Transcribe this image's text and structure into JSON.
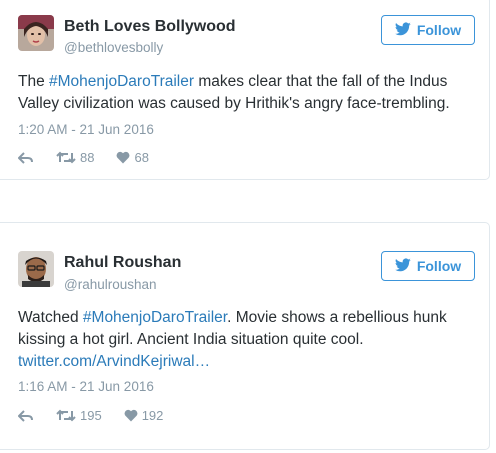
{
  "tweets": [
    {
      "name": "Beth Loves Bollywood",
      "handle": "@bethlovesbolly",
      "follow_label": "Follow",
      "text_parts": [
        "The ",
        "#MohenjoDaroTrailer",
        " makes clear that the fall of the Indus Valley civilization was caused by Hrithik's angry face-trembling."
      ],
      "timestamp": "1:20 AM - 21 Jun 2016",
      "retweets": "88",
      "likes": "68"
    },
    {
      "name": "Rahul Roushan",
      "handle": "@rahulroushan",
      "follow_label": "Follow",
      "text_parts": [
        "Watched ",
        "#MohenjoDaroTrailer",
        ". Movie shows a rebellious hunk kissing a hot girl. Ancient India situation quite cool.",
        "twitter.com/ArvindKejriwal…"
      ],
      "timestamp": "1:16 AM - 21 Jun 2016",
      "retweets": "195",
      "likes": "192"
    }
  ],
  "colors": {
    "accent": "#3b94d9",
    "link": "#2b7bb9",
    "text": "#292f33",
    "muted": "#8899a6",
    "border": "#e1e8ed"
  },
  "icons": [
    "twitter-bird-icon",
    "reply-icon",
    "retweet-icon",
    "heart-icon"
  ]
}
